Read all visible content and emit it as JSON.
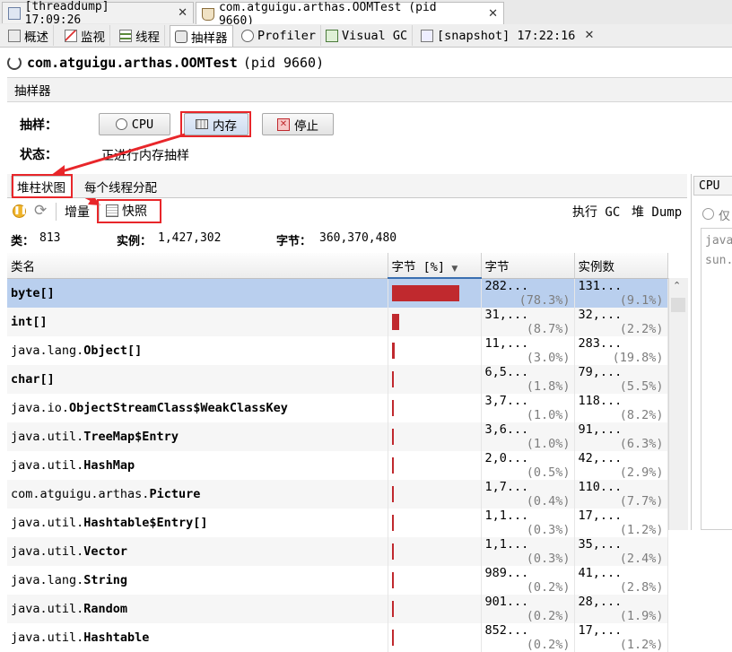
{
  "doc_tabs": [
    {
      "label": "[threaddump] 17:09:26"
    },
    {
      "label": "com.atguigu.arthas.OOMTest (pid 9660)"
    }
  ],
  "sub_tabs": [
    {
      "label": "概述"
    },
    {
      "label": "监视"
    },
    {
      "label": "线程"
    },
    {
      "label": "抽样器"
    },
    {
      "label": "Profiler"
    },
    {
      "label": "Visual GC"
    },
    {
      "label": "[snapshot] 17:22:16"
    }
  ],
  "page_title": "com.atguigu.arthas.OOMTest",
  "page_pid": "(pid 9660)",
  "section_label": "抽样器",
  "sampler": {
    "label": "抽样：",
    "cpu_button": "CPU",
    "memory_button": "内存",
    "stop_button": "停止",
    "status_label": "状态：",
    "status_value": "正进行内存抽样"
  },
  "inner_tabs": [
    {
      "label": "堆柱状图"
    },
    {
      "label": "每个线程分配"
    }
  ],
  "toolbar": {
    "delta_label": "增量",
    "snapshot_label": "快照",
    "gc_label": "执行 GC",
    "heap_dump_label": "堆 Dump"
  },
  "stats": {
    "classes_label": "类：",
    "classes_value": "813",
    "instances_label": "实例：",
    "instances_value": "1,427,302",
    "bytes_label": "字节：",
    "bytes_value": "360,370,480"
  },
  "table": {
    "columns": [
      "类名",
      "字节 [%]",
      "字节",
      "实例数"
    ],
    "rows": [
      {
        "pkg": "",
        "cls": "byte[]",
        "bytes": "282...",
        "bpct": "(78.3%)",
        "inst": "131...",
        "ipct": "(9.1%)",
        "bar": 78.3
      },
      {
        "pkg": "",
        "cls": "int[]",
        "bytes": "31,...",
        "bpct": "(8.7%)",
        "inst": "32,...",
        "ipct": "(2.2%)",
        "bar": 8.7
      },
      {
        "pkg": "java.lang.",
        "cls": "Object[]",
        "bytes": "11,...",
        "bpct": "(3.0%)",
        "inst": "283...",
        "ipct": "(19.8%)",
        "bar": 3.0
      },
      {
        "pkg": "",
        "cls": "char[]",
        "bytes": "6,5...",
        "bpct": "(1.8%)",
        "inst": "79,...",
        "ipct": "(5.5%)",
        "bar": 1.8
      },
      {
        "pkg": "java.io.",
        "cls": "ObjectStreamClass$WeakClassKey",
        "bytes": "3,7...",
        "bpct": "(1.0%)",
        "inst": "118...",
        "ipct": "(8.2%)",
        "bar": 1.0
      },
      {
        "pkg": "java.util.",
        "cls": "TreeMap$Entry",
        "bytes": "3,6...",
        "bpct": "(1.0%)",
        "inst": "91,...",
        "ipct": "(6.3%)",
        "bar": 1.0
      },
      {
        "pkg": "java.util.",
        "cls": "HashMap",
        "bytes": "2,0...",
        "bpct": "(0.5%)",
        "inst": "42,...",
        "ipct": "(2.9%)",
        "bar": 0.5
      },
      {
        "pkg": "com.atguigu.arthas.",
        "cls": "Picture",
        "bytes": "1,7...",
        "bpct": "(0.4%)",
        "inst": "110...",
        "ipct": "(7.7%)",
        "bar": 0.4
      },
      {
        "pkg": "java.util.",
        "cls": "Hashtable$Entry[]",
        "bytes": "1,1...",
        "bpct": "(0.3%)",
        "inst": "17,...",
        "ipct": "(1.2%)",
        "bar": 0.3
      },
      {
        "pkg": "java.util.",
        "cls": "Vector",
        "bytes": "1,1...",
        "bpct": "(0.3%)",
        "inst": "35,...",
        "ipct": "(2.4%)",
        "bar": 0.3
      },
      {
        "pkg": "java.lang.",
        "cls": "String",
        "bytes": "989...",
        "bpct": "(0.2%)",
        "inst": "41,...",
        "ipct": "(2.8%)",
        "bar": 0.2
      },
      {
        "pkg": "java.util.",
        "cls": "Random",
        "bytes": "901...",
        "bpct": "(0.2%)",
        "inst": "28,...",
        "ipct": "(1.9%)",
        "bar": 0.2
      },
      {
        "pkg": "java.util.",
        "cls": "Hashtable",
        "bytes": "852...",
        "bpct": "(0.2%)",
        "inst": "17,...",
        "ipct": "(1.2%)",
        "bar": 0.2
      }
    ]
  },
  "right_panel": {
    "tab_label": "CPU",
    "radio_label": "仅",
    "lines": [
      "java",
      "sun."
    ]
  },
  "colors": {
    "bar": "#c0292e",
    "highlight": "#e8262a",
    "selection": "#b9cfee"
  }
}
